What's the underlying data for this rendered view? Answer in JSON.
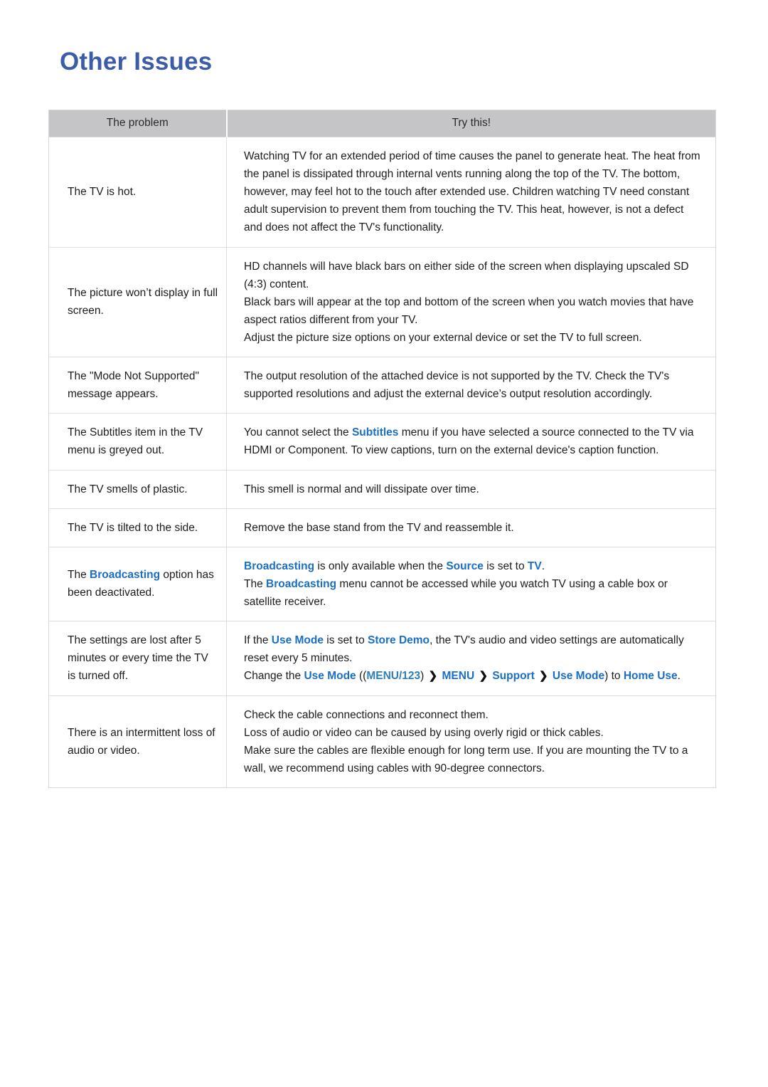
{
  "page": {
    "title": "Other Issues"
  },
  "table": {
    "headers": {
      "problem": "The problem",
      "try": "Try this!"
    },
    "rows": [
      {
        "problem_plain": "The TV is hot.",
        "try_lines": [
          "Watching TV for an extended period of time causes the panel to generate heat. The heat from the panel is dissipated through internal vents running along the top of the TV. The bottom, however, may feel hot to the touch after extended use. Children watching TV need constant adult supervision to prevent them from touching the TV. This heat, however, is not a defect and does not affect the TV's functionality."
        ]
      },
      {
        "problem_plain": "The picture won’t display in full screen.",
        "try_lines": [
          "HD channels will have black bars on either side of the screen when displaying upscaled SD (4:3) content.",
          "Black bars will appear at the top and bottom of the screen when you watch movies that have aspect ratios different from your TV.",
          "Adjust the picture size options on your external device or set the TV to full screen."
        ]
      },
      {
        "problem_plain": "The \"Mode Not Supported\" message appears.",
        "try_lines": [
          "The output resolution of the attached device is not supported by the TV. Check the TV's supported resolutions and adjust the external device’s output resolution accordingly."
        ]
      },
      {
        "problem_plain": "The Subtitles item in the TV menu is greyed out.",
        "try_rich": {
          "before": "You cannot select the ",
          "link": "Subtitles",
          "after": " menu if you have selected a source connected to the TV via HDMI or Component. To view captions, turn on the external device's caption function."
        }
      },
      {
        "problem_plain": "The TV smells of plastic.",
        "try_lines": [
          "This smell is normal and will dissipate over time."
        ]
      },
      {
        "problem_plain": "The TV is tilted to the side.",
        "try_lines": [
          "Remove the base stand from the TV and reassemble it."
        ]
      },
      {
        "problem_rich": {
          "before": "The ",
          "link": "Broadcasting",
          "after": " option has been deactivated."
        },
        "try_rich_broadcast": {
          "l1_link1": "Broadcasting",
          "l1_mid": " is only available when the ",
          "l1_link2": "Source",
          "l1_mid2": " is set to ",
          "l1_link3": "TV",
          "l1_end": ".",
          "l2_before": "The ",
          "l2_link": "Broadcasting",
          "l2_after": " menu cannot be accessed while you watch TV using a cable box or satellite receiver."
        }
      },
      {
        "problem_plain": "The settings are lost after 5 minutes or every time the TV is turned off.",
        "try_rich_usemode": {
          "l1_before": "If the ",
          "l1_link1": "Use Mode",
          "l1_mid": " is set to ",
          "l1_link2": "Store Demo",
          "l1_after": ", the TV's audio and video settings are automatically reset every 5 minutes.",
          "l2_before": "Change the ",
          "l2_link1": "Use Mode",
          "l2_paren_open": " ((",
          "l2_menu123": "MENU/123",
          "l2_paren_close": ") ",
          "l2_chevron1": "❯",
          "l2_menu": " MENU ",
          "l2_chevron2": "❯",
          "l2_support": " Support ",
          "l2_chevron3": "❯",
          "l2_usemode": " Use Mode",
          "l2_close": ") to ",
          "l2_home": "Home Use",
          "l2_period": "."
        }
      },
      {
        "problem_plain": "There is an intermittent loss of audio or video.",
        "try_lines": [
          "Check the cable connections and reconnect them.",
          "Loss of audio or video can be caused by using overly rigid or thick cables.",
          "Make sure the cables are flexible enough for long term use. If you are mounting the TV to a wall, we recommend using cables with 90-degree connectors."
        ]
      }
    ]
  },
  "colors": {
    "title_blue": "#3c5ca8",
    "link_blue": "#1a6fc4",
    "link_blue_soft": "#2d7fb8",
    "header_gray": "#c5c5c7",
    "border_gray": "#dcdce2"
  }
}
